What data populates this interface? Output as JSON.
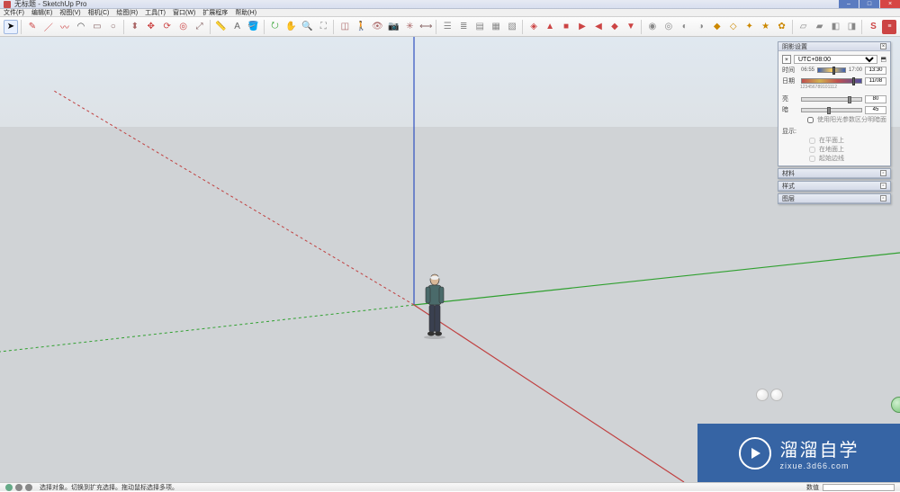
{
  "window": {
    "title": "无标题 - SketchUp Pro"
  },
  "menubar": {
    "items": [
      "文件(F)",
      "编辑(E)",
      "视图(V)",
      "相机(C)",
      "绘图(R)",
      "工具(T)",
      "窗口(W)",
      "扩展程序",
      "帮助(H)"
    ]
  },
  "toolbar": {
    "groups": [
      [
        "select",
        "eraser",
        "pencil",
        "line",
        "rect",
        "arc",
        "rect2",
        "circle"
      ],
      [
        "hand",
        "orbit",
        "pushpull",
        "rotate",
        "scale",
        "offset"
      ],
      [
        "zoom-extents",
        "zoom",
        "text",
        "dimension"
      ],
      [
        "walk",
        "look",
        "section",
        "3dtext",
        "follow",
        "axes",
        "tape"
      ],
      [
        "iso",
        "top",
        "front",
        "right",
        "back",
        "left"
      ],
      [
        "move",
        "rotate2",
        "scale2",
        "offset2",
        "outer",
        "curve",
        "weld"
      ],
      [
        "paint",
        "material",
        "texture",
        "sandbox",
        "drape"
      ],
      [
        "layer",
        "scene",
        "undo",
        "redo",
        "su-logo",
        "fredo"
      ]
    ]
  },
  "shadow_panel": {
    "title": "阴影设置",
    "timezone_label": "",
    "timezone_value": "UTC+08:00",
    "time_label": "时间",
    "time_start": "06:55",
    "time_end": "17:00",
    "time_value": "13:30",
    "date_label": "日期",
    "date_ticks": "123456789101112",
    "date_value": "11/08",
    "light_label": "亮",
    "light_value": "80",
    "dark_label": "暗",
    "dark_value": "45",
    "sunlight_checkbox": "使用阳光参数区分明暗面",
    "display_label": "显示:",
    "display_faces": "在平面上",
    "display_ground": "在地面上",
    "display_edges": "起始边线"
  },
  "trays": {
    "materials": "材料",
    "styles": "样式",
    "layers": "图层"
  },
  "statusbar": {
    "hint": "选择对象。切换到扩充选择。拖动鼠标选择多项。",
    "value_label": "数值"
  },
  "watermark": {
    "brand": "溜溜自学",
    "url": "zixue.3d66.com"
  }
}
